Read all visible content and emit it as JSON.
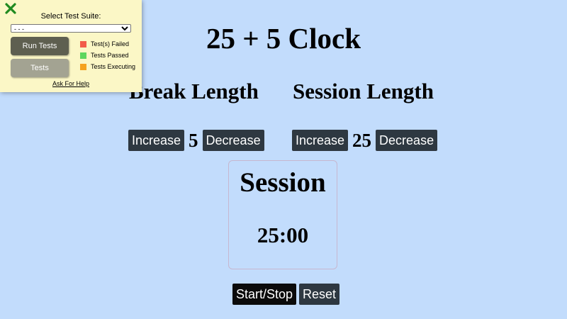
{
  "title": "25 + 5 Clock",
  "break": {
    "label": "Break Length",
    "increment_label": "Increase",
    "length": "5",
    "decrement_label": "Decrease"
  },
  "session": {
    "label": "Session Length",
    "increment_label": "Increase",
    "length": "25",
    "decrement_label": "Decrease"
  },
  "timer": {
    "label": "Session",
    "time_left": "25:00"
  },
  "controls": {
    "start_stop_label": "Start/Stop",
    "reset_label": "Reset"
  },
  "test_panel": {
    "close_icon": "close-x-icon",
    "suite_label": "Select Test Suite:",
    "suite_selected": "- - -",
    "run_tests_label": "Run Tests",
    "tests_label": "Tests",
    "legend": [
      {
        "label": "Test(s) Failed",
        "color": "#f25c4a"
      },
      {
        "label": "Tests Passed",
        "color": "#5ed65e"
      },
      {
        "label": "Tests Executing",
        "color": "#f5a21e"
      }
    ],
    "help_label": "Ask For Help"
  },
  "colors": {
    "background": "#c2dcfc",
    "button": "#2e3841",
    "panel": "#fbf7c6",
    "close_icon": "#1f8a1f"
  }
}
